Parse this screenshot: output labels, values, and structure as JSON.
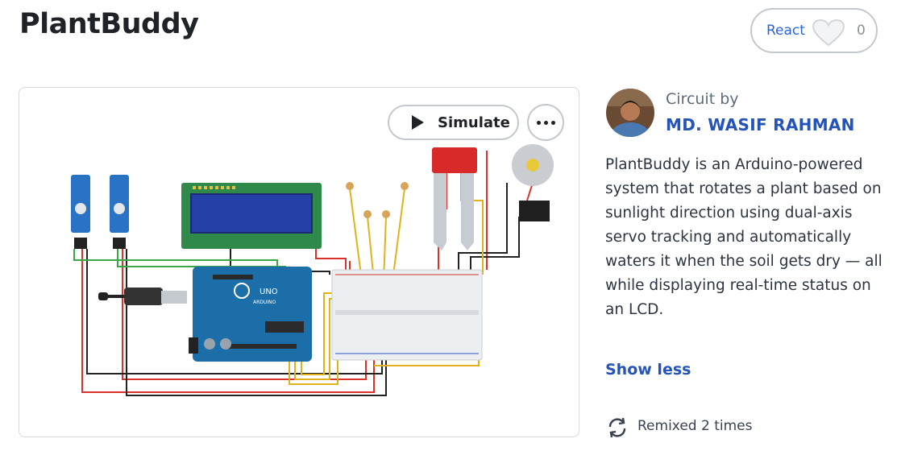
{
  "header": {
    "title": "PlantBuddy",
    "react": {
      "label": "React",
      "count": "0"
    }
  },
  "canvas": {
    "simulate_label": "Simulate",
    "more_icon": "more-horizontal-icon",
    "board_label": "UNO",
    "board_brand": "ARDUINO"
  },
  "sidebar": {
    "circuit_by": "Circuit by",
    "author": "MD. WASIF RAHMAN",
    "description": "PlantBuddy is an Arduino-powered system that rotates a plant based on sunlight direction using dual-axis servo tracking and automatically waters it when the soil gets dry — all while displaying real-time status on an LCD.",
    "show_less": "Show less",
    "remix_text": "Remixed 2 times",
    "remix_icon": "remix-icon"
  },
  "colors": {
    "link": "#2454b8",
    "react_label": "#2a63d4",
    "border": "#c3c8cf"
  }
}
